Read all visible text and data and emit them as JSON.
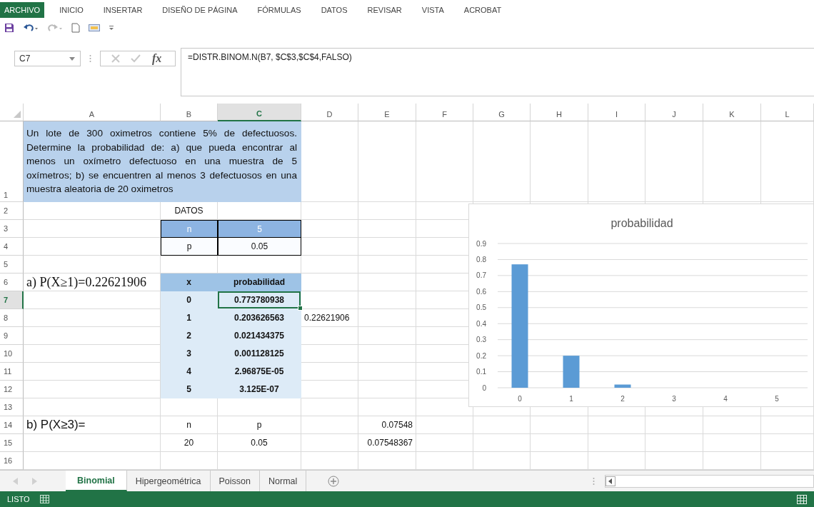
{
  "ribbon_tabs": [
    {
      "label": "ARCHIVO",
      "kind": "file"
    },
    {
      "label": "INICIO",
      "kind": "tab"
    },
    {
      "label": "INSERTAR",
      "kind": "tab"
    },
    {
      "label": "DISEÑO DE PÁGINA",
      "kind": "tab"
    },
    {
      "label": "FÓRMULAS",
      "kind": "tab"
    },
    {
      "label": "DATOS",
      "kind": "tab"
    },
    {
      "label": "REVISAR",
      "kind": "tab"
    },
    {
      "label": "VISTA",
      "kind": "tab"
    },
    {
      "label": "ACROBAT",
      "kind": "tab"
    }
  ],
  "formula_bar": {
    "name_box": "C7",
    "function_label": "fx",
    "formula": "=DISTR.BINOM.N(B7, $C$3,$C$4,FALSO)"
  },
  "columns": [
    "A",
    "B",
    "C",
    "D",
    "E",
    "F",
    "G",
    "H",
    "I",
    "J",
    "K",
    "L"
  ],
  "rows": [
    {
      "number": "1",
      "cells": {
        "A": {
          "text": "Un lote de 300 oximetros contiene 5% de defectuosos. Determine la probabilidad de: a) que pueda encontrar al menos un oxímetro defectuoso en una muestra de 5 oxímetros; b) se encuentren al menos 3 defectuosos en una muestra aleatoria de 20 oximetros",
          "kind": "problem",
          "selected": false
        }
      }
    },
    {
      "number": "2",
      "cells": {
        "B": {
          "text": "DATOS",
          "kind": "center",
          "selected": false
        }
      }
    },
    {
      "number": "3",
      "cells": {
        "B": {
          "text": "n",
          "kind": "param-head",
          "selected": false
        },
        "C": {
          "text": "5",
          "kind": "param-head",
          "selected": false
        }
      }
    },
    {
      "number": "4",
      "cells": {
        "B": {
          "text": "p",
          "kind": "param",
          "selected": false
        },
        "C": {
          "text": "0.05",
          "kind": "param",
          "selected": false
        }
      }
    },
    {
      "number": "5"
    },
    {
      "number": "6",
      "cells": {
        "A": {
          "text": "a) P(X≥1)=0.22621906",
          "kind": "note-serif",
          "selected": false
        },
        "B": {
          "text": "x",
          "kind": "head",
          "selected": false
        },
        "C": {
          "text": "probabilidad",
          "kind": "head",
          "selected": false
        }
      }
    },
    {
      "number": "7",
      "cells": {
        "B": {
          "text": "0",
          "kind": "body",
          "selected": false
        },
        "C": {
          "text": "0.773780938",
          "kind": "body",
          "selected": true
        }
      }
    },
    {
      "number": "8",
      "cells": {
        "B": {
          "text": "1",
          "kind": "body",
          "selected": false
        },
        "C": {
          "text": "0.203626563",
          "kind": "body",
          "selected": false
        },
        "D": {
          "text": "0.22621906",
          "kind": "text",
          "selected": false
        }
      }
    },
    {
      "number": "9",
      "cells": {
        "B": {
          "text": "2",
          "kind": "body",
          "selected": false
        },
        "C": {
          "text": "0.021434375",
          "kind": "body",
          "selected": false
        }
      }
    },
    {
      "number": "10",
      "cells": {
        "B": {
          "text": "3",
          "kind": "body",
          "selected": false
        },
        "C": {
          "text": "0.001128125",
          "kind": "body",
          "selected": false
        }
      }
    },
    {
      "number": "11",
      "cells": {
        "B": {
          "text": "4",
          "kind": "body",
          "selected": false
        },
        "C": {
          "text": "2.96875E-05",
          "kind": "body",
          "selected": false
        }
      }
    },
    {
      "number": "12",
      "cells": {
        "B": {
          "text": "5",
          "kind": "body",
          "selected": false
        },
        "C": {
          "text": "3.125E-07",
          "kind": "body",
          "selected": false
        }
      }
    },
    {
      "number": "13"
    },
    {
      "number": "14",
      "cells": {
        "A": {
          "text": "b) P(X≥3)=",
          "kind": "note",
          "selected": false
        },
        "B": {
          "text": "n",
          "kind": "center",
          "selected": false
        },
        "C": {
          "text": "p",
          "kind": "center",
          "selected": false
        },
        "E": {
          "text": "0.07548",
          "kind": "value",
          "selected": false
        }
      }
    },
    {
      "number": "15",
      "cells": {
        "B": {
          "text": "20",
          "kind": "center",
          "selected": false
        },
        "C": {
          "text": "0.05",
          "kind": "center",
          "selected": false
        },
        "E": {
          "text": "0.07548367",
          "kind": "value",
          "selected": false
        }
      }
    },
    {
      "number": "16"
    }
  ],
  "chart": {
    "chart_data": {
      "type": "bar",
      "title": "probabilidad",
      "categories": [
        "0",
        "1",
        "2",
        "3",
        "4",
        "5"
      ],
      "series": [
        {
          "color": "#5b9bd5",
          "values": [
            0.77,
            0.2,
            0.02,
            0,
            0,
            0
          ]
        }
      ],
      "grid": true,
      "ylim": [
        0,
        0.9
      ],
      "yticks": [
        0,
        0.1,
        0.2,
        0.3,
        0.4,
        0.5,
        0.6,
        0.7,
        0.8,
        0.9
      ]
    }
  },
  "sheet_tabs": [
    {
      "label": "Binomial",
      "selected": true
    },
    {
      "label": "Hipergeométrica",
      "selected": false
    },
    {
      "label": "Poisson",
      "selected": false
    },
    {
      "label": "Normal",
      "selected": false
    }
  ],
  "status_bar": {
    "text": "LISTO"
  }
}
